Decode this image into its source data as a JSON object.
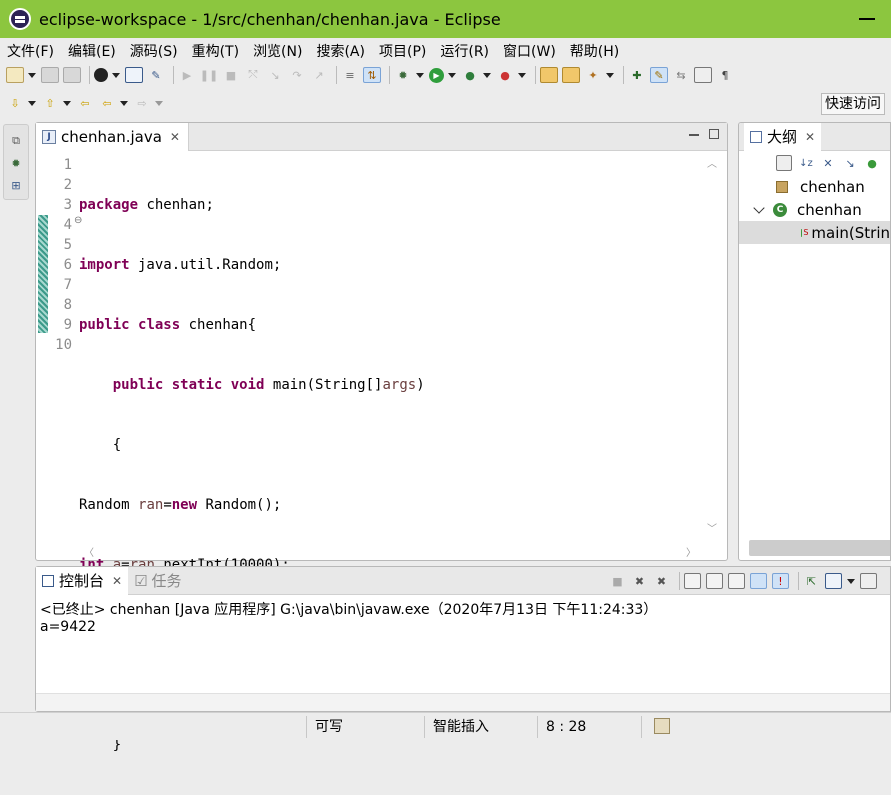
{
  "window": {
    "title": "eclipse-workspace - 1/src/chenhan/chenhan.java - Eclipse"
  },
  "menu": {
    "items": [
      "文件(F)",
      "编辑(E)",
      "源码(S)",
      "重构(T)",
      "浏览(N)",
      "搜索(A)",
      "项目(P)",
      "运行(R)",
      "窗口(W)",
      "帮助(H)"
    ]
  },
  "toolbar": {
    "quick_access": "快速访问"
  },
  "editor": {
    "tab_label": "chenhan.java",
    "line_numbers": [
      "1",
      "2",
      "3",
      "4",
      "5",
      "6",
      "7",
      "8",
      "9",
      "10"
    ],
    "current_line": 8
  },
  "outline": {
    "tab_label": "大纲",
    "package": "chenhan",
    "class": "chenhan",
    "method": "main(Strin"
  },
  "console": {
    "tab_label": "控制台",
    "tasks_label": "任务",
    "header": "<已终止> chenhan [Java 应用程序] G:\\java\\bin\\javaw.exe（2020年7月13日 下午11:24:33）",
    "output": "a=9422"
  },
  "status": {
    "writable": "可写",
    "insert_mode": "智能插入",
    "position": "8 : 28"
  },
  "colors": {
    "titlebar": "#8cc63f",
    "keyword": "#7f0055",
    "string": "#2a00ff",
    "field": "#0000c0",
    "variable": "#6a3e3e"
  }
}
